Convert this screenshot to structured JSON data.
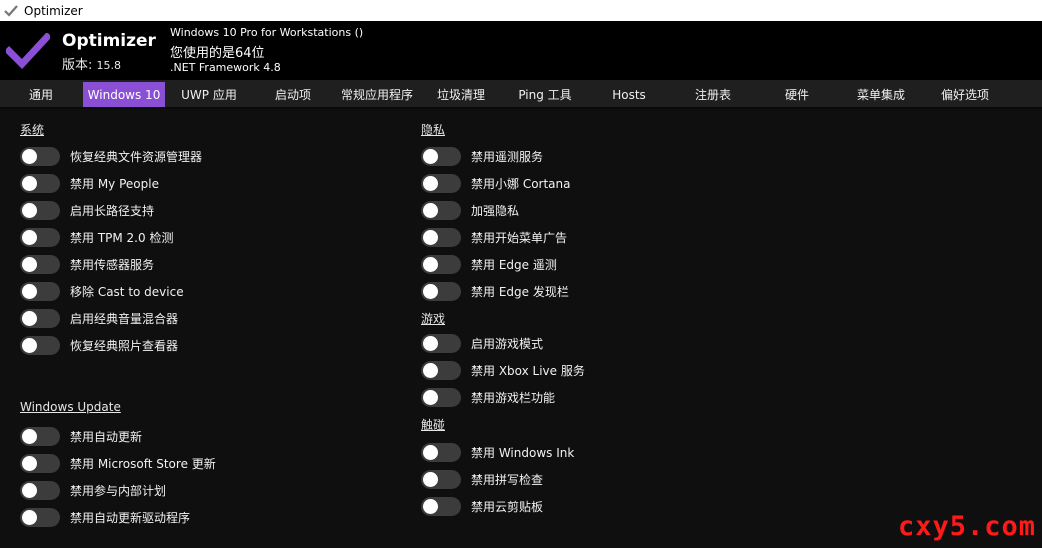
{
  "window": {
    "title": "Optimizer"
  },
  "header": {
    "app_name": "Optimizer",
    "version_label": "版本:",
    "version_number": "15.8",
    "os_name": "Windows 10 Pro for Workstations ()",
    "bitness": "您使用的是64位",
    "framework": ".NET Framework 4.8",
    "accent_color": "#8a4fd4"
  },
  "tabs": [
    {
      "label": "通用",
      "active": false
    },
    {
      "label": "Windows 10",
      "active": true
    },
    {
      "label": "UWP 应用",
      "active": false
    },
    {
      "label": "启动项",
      "active": false
    },
    {
      "label": "常规应用程序",
      "active": false
    },
    {
      "label": "垃圾清理",
      "active": false
    },
    {
      "label": "Ping 工具",
      "active": false
    },
    {
      "label": "Hosts",
      "active": false
    },
    {
      "label": "注册表",
      "active": false
    },
    {
      "label": "硬件",
      "active": false
    },
    {
      "label": "菜单集成",
      "active": false
    },
    {
      "label": "偏好选项",
      "active": false
    }
  ],
  "sections": {
    "system": {
      "title": "系统",
      "items": [
        "恢复经典文件资源管理器",
        "禁用 My People",
        "启用长路径支持",
        "禁用 TPM 2.0 检测",
        "禁用传感器服务",
        "移除 Cast to device",
        "启用经典音量混合器",
        "恢复经典照片查看器"
      ]
    },
    "update": {
      "title": "Windows Update",
      "items": [
        "禁用自动更新",
        "禁用 Microsoft Store 更新",
        "禁用参与内部计划",
        "禁用自动更新驱动程序"
      ]
    },
    "privacy": {
      "title": "隐私",
      "items": [
        "禁用遥测服务",
        "禁用小娜 Cortana",
        "加强隐私",
        "禁用开始菜单广告",
        "禁用 Edge 遥测",
        "禁用 Edge 发现栏"
      ]
    },
    "gaming": {
      "title": "游戏",
      "items": [
        "启用游戏模式",
        "禁用 Xbox Live 服务",
        "禁用游戏栏功能"
      ]
    },
    "touch": {
      "title": "触碰",
      "items": [
        "禁用 Windows Ink",
        "禁用拼写检查",
        "禁用云剪贴板"
      ]
    }
  },
  "watermark": "cxy5.com"
}
